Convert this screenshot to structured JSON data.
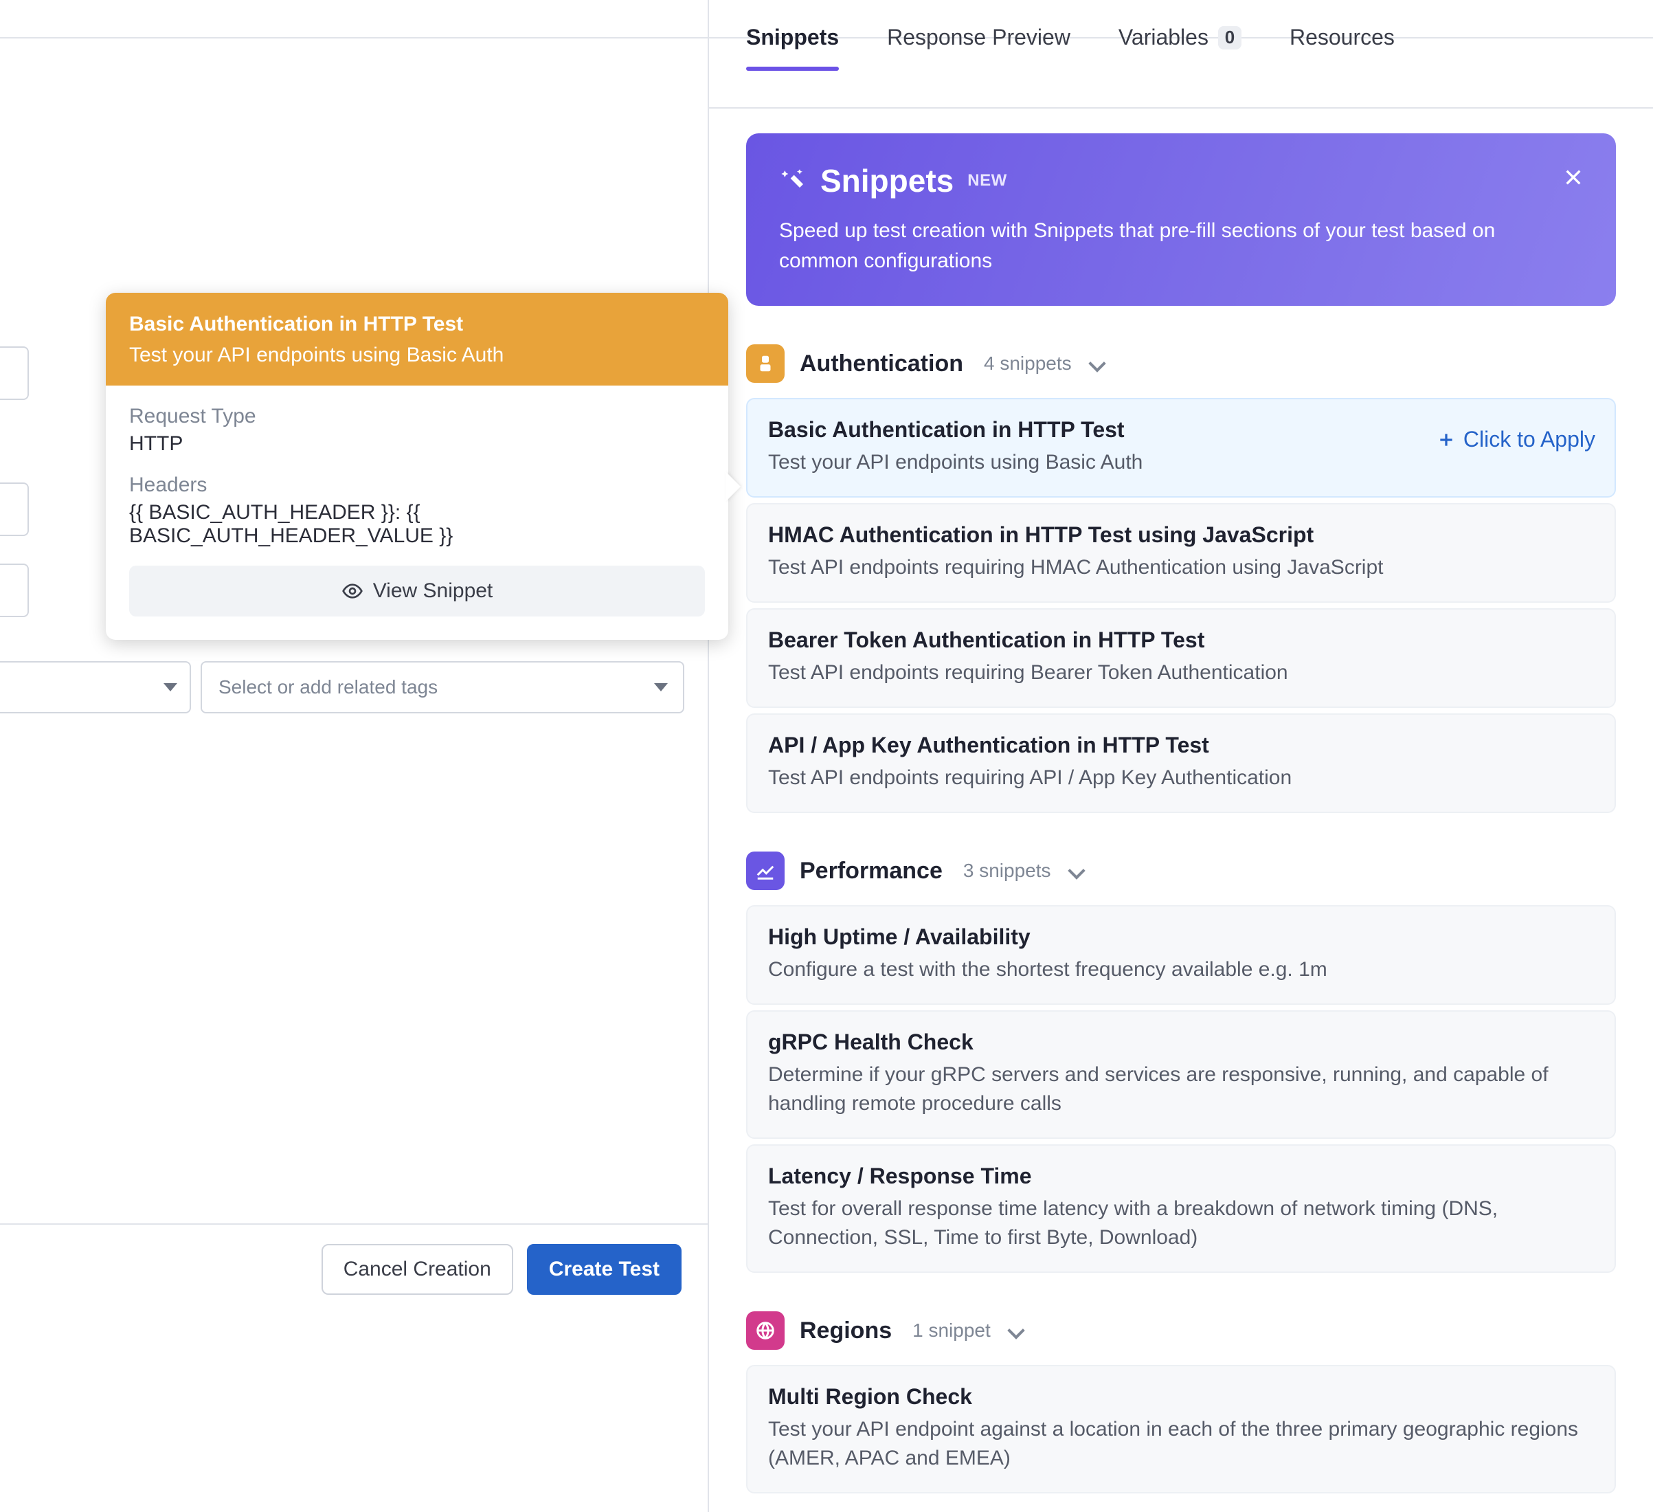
{
  "left": {
    "tags_placeholder": "Select or add related tags",
    "cancel_label": "Cancel Creation",
    "create_label": "Create Test"
  },
  "popover": {
    "title": "Basic Authentication in HTTP Test",
    "subtitle": "Test your API endpoints using Basic Auth",
    "request_type_label": "Request Type",
    "request_type_value": "HTTP",
    "headers_label": "Headers",
    "headers_value": "{{ BASIC_AUTH_HEADER }}: {{ BASIC_AUTH_HEADER_VALUE }}",
    "view_snippet_label": "View Snippet"
  },
  "tabs": {
    "snippets": "Snippets",
    "response_preview": "Response Preview",
    "variables": "Variables",
    "variables_count": "0",
    "resources": "Resources"
  },
  "banner": {
    "title": "Snippets",
    "new_badge": "NEW",
    "text": "Speed up test creation with Snippets that pre-fill sections of your test based on common configurations"
  },
  "apply_label": "Click to Apply",
  "categories": [
    {
      "id": "auth",
      "icon_color": "orange",
      "title": "Authentication",
      "count": "4 snippets",
      "items": [
        {
          "title": "Basic Authentication in HTTP Test",
          "desc": "Test your API endpoints using Basic Auth",
          "selected": true
        },
        {
          "title": "HMAC Authentication in HTTP Test using JavaScript",
          "desc": "Test API endpoints requiring HMAC Authentication using JavaScript"
        },
        {
          "title": "Bearer Token Authentication in HTTP Test",
          "desc": "Test API endpoints requiring Bearer Token Authentication"
        },
        {
          "title": "API / App Key Authentication in HTTP Test",
          "desc": "Test API endpoints requiring API / App Key Authentication"
        }
      ]
    },
    {
      "id": "perf",
      "icon_color": "purple",
      "title": "Performance",
      "count": "3 snippets",
      "items": [
        {
          "title": "High Uptime / Availability",
          "desc": "Configure a test with the shortest frequency available e.g. 1m"
        },
        {
          "title": "gRPC Health Check",
          "desc": "Determine if your gRPC servers and services are responsive, running, and capable of handling remote procedure calls"
        },
        {
          "title": "Latency / Response Time",
          "desc": "Test for overall response time latency with a breakdown of network timing (DNS, Connection, SSL, Time to first Byte, Download)"
        }
      ]
    },
    {
      "id": "regions",
      "icon_color": "magenta",
      "title": "Regions",
      "count": "1 snippet",
      "items": [
        {
          "title": "Multi Region Check",
          "desc": "Test your API endpoint against a location in each of the three primary geographic regions (AMER, APAC and EMEA)"
        }
      ]
    }
  ]
}
